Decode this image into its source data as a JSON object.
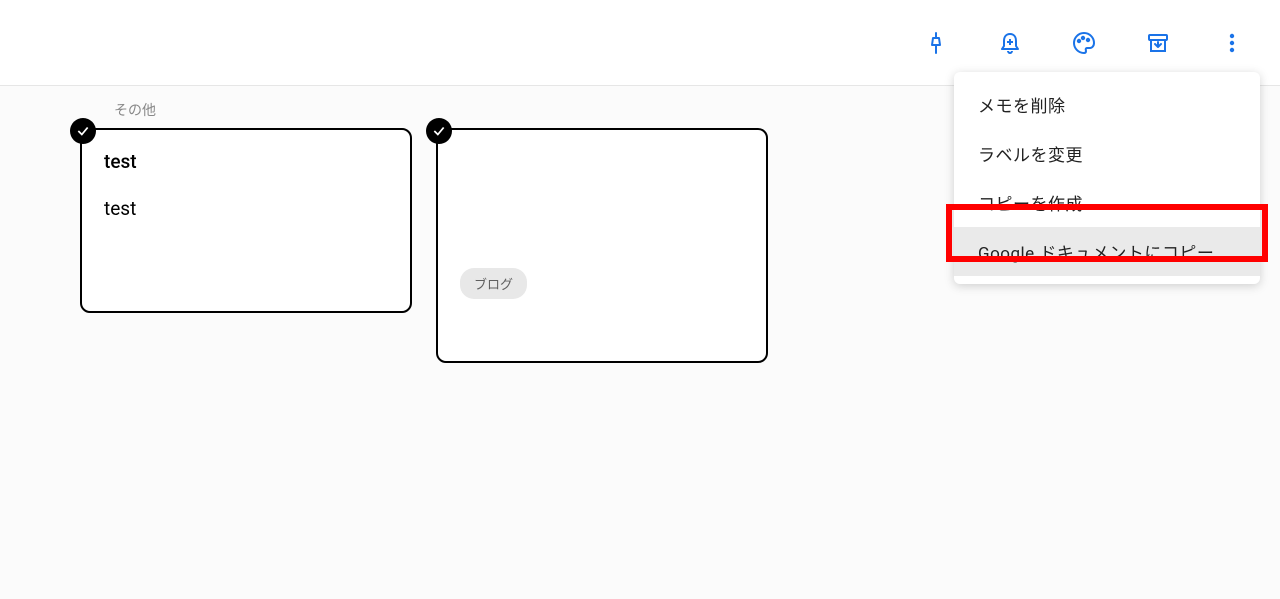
{
  "section": {
    "label": "その他"
  },
  "notes": [
    {
      "title": "test",
      "body": "test"
    },
    {
      "label": "ブログ"
    }
  ],
  "menu": {
    "items": [
      "メモを削除",
      "ラベルを変更",
      "コピーを作成",
      "Google ドキュメントにコピー"
    ]
  },
  "icons": {
    "pin": "pin-icon",
    "reminder": "reminder-icon",
    "palette": "palette-icon",
    "archive": "archive-icon",
    "more": "more-icon"
  }
}
